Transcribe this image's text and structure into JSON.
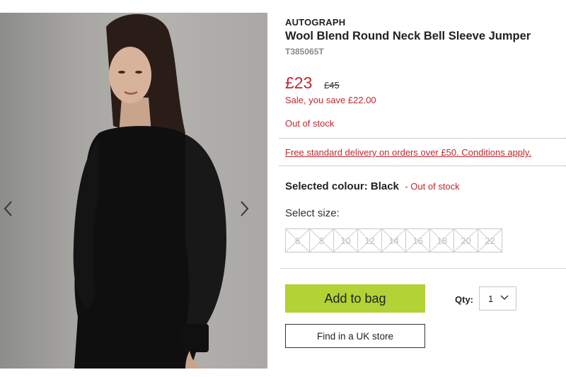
{
  "product": {
    "brand": "AUTOGRAPH",
    "title": "Wool Blend Round Neck Bell Sleeve Jumper",
    "sku": "T385065T",
    "price_now": "£23",
    "price_was": "£45",
    "save_text": "Sale, you save £22.00",
    "stock_text": "Out of stock"
  },
  "delivery": {
    "link_text": "Free standard delivery on orders over £50. Conditions apply."
  },
  "colour": {
    "label": "Selected colour: Black",
    "stock_text": "- Out of stock"
  },
  "size": {
    "label": "Select size:",
    "options": [
      "6",
      "8",
      "10",
      "12",
      "14",
      "16",
      "18",
      "20",
      "22"
    ],
    "all_unavailable": true
  },
  "actions": {
    "add_to_bag": "Add to bag",
    "qty_label": "Qty:",
    "qty_value": "1",
    "find_store": "Find in a UK store"
  },
  "gallery": {
    "prev_icon": "chevron-left-icon",
    "next_icon": "chevron-right-icon",
    "image_subject": "model wearing black bell sleeve jumper"
  },
  "colors": {
    "accent_red": "#c0272d",
    "add_button_green": "#b2d235"
  }
}
